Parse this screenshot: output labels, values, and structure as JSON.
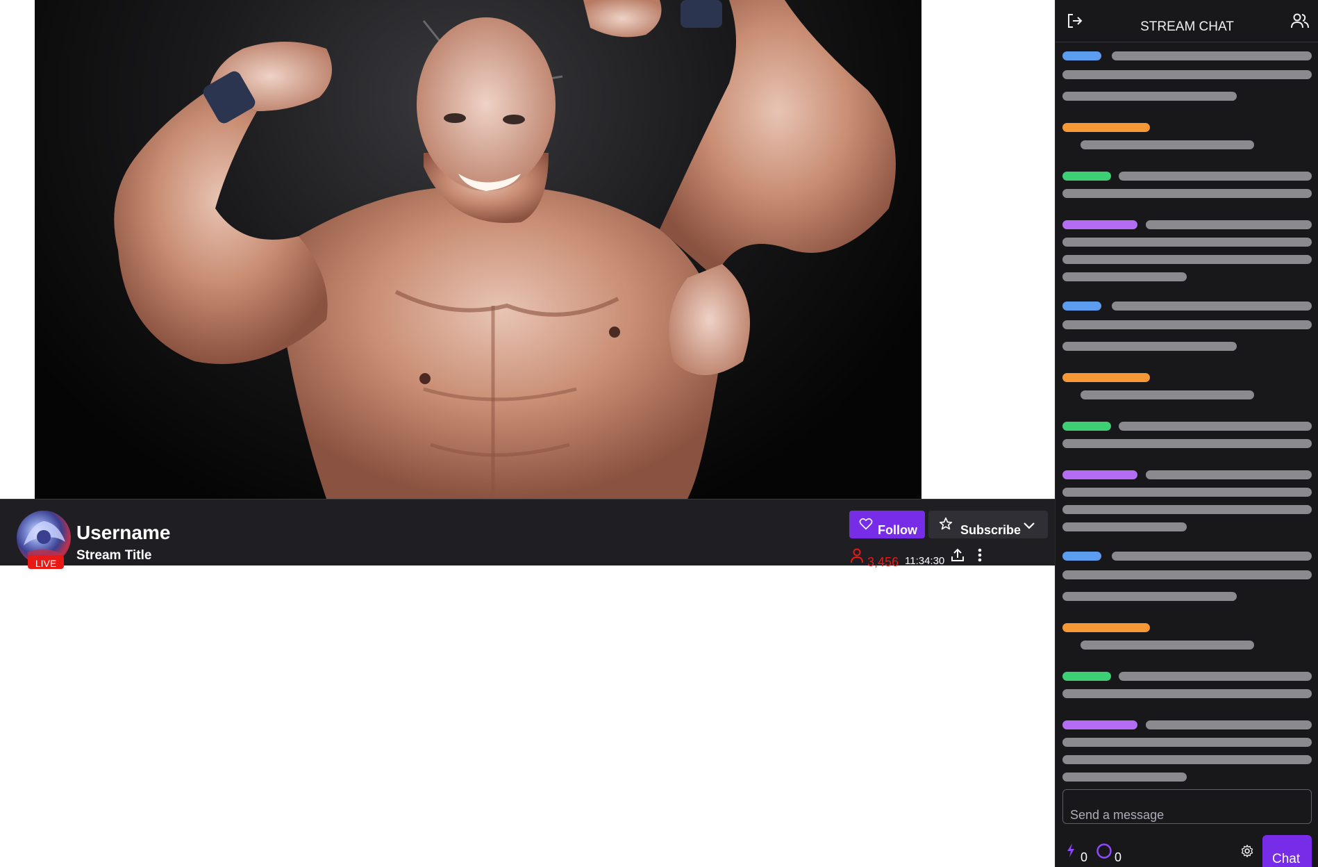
{
  "stream": {
    "username": "Username",
    "title": "Stream Title",
    "live_badge": "LIVE",
    "viewer_count": "3,456",
    "uptime": "11:34:30"
  },
  "actions": {
    "follow_label": "Follow",
    "subscribe_label": "Subscribe"
  },
  "chat": {
    "title": "STREAM CHAT",
    "input_placeholder": "Send a message",
    "bits_count": "0",
    "points_count": "0",
    "send_label": "Chat"
  },
  "colors": {
    "accent": "#772ce8",
    "live": "#e91916",
    "chat_bg": "#18181b",
    "info_bar_bg": "#1f1f23",
    "username_colors": [
      "#5c9df0",
      "#f79735",
      "#3ccf73",
      "#b56cf4"
    ]
  },
  "icons": {
    "follow": "heart-icon",
    "subscribe": "star-icon",
    "dropdown": "chevron-down-icon",
    "viewers": "person-icon",
    "share": "share-icon",
    "more": "more-vertical-icon",
    "collapse": "collapse-icon",
    "users": "users-icon",
    "bits": "bits-icon",
    "points": "channel-points-icon",
    "settings": "gear-icon"
  }
}
